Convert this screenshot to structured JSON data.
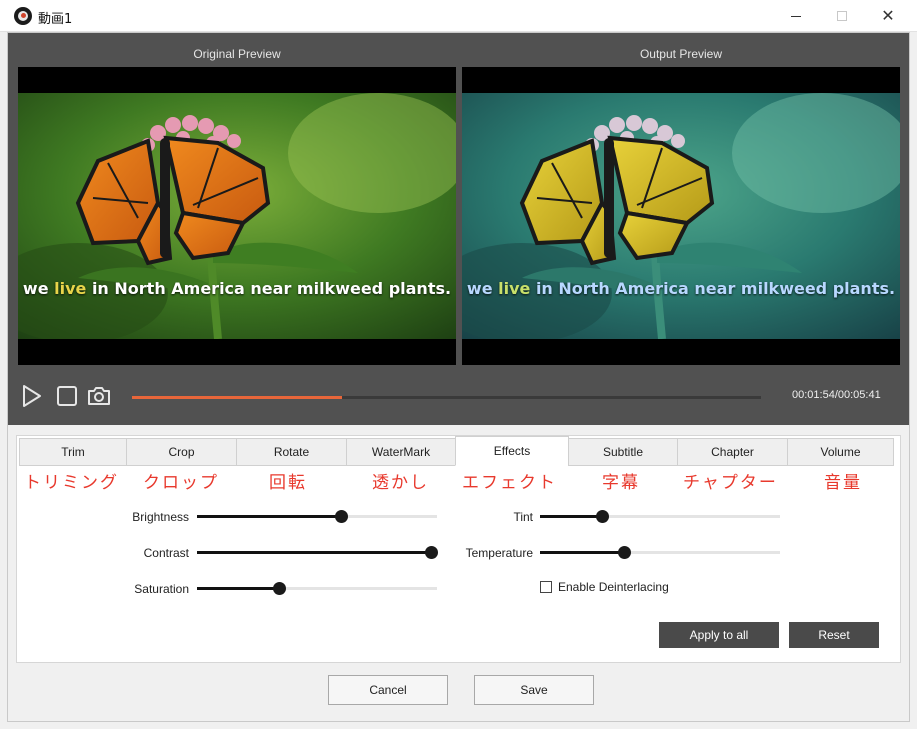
{
  "window": {
    "title": "動画1",
    "close_glyph": "✕"
  },
  "preview": {
    "original_label": "Original Preview",
    "output_label": "Output Preview",
    "caption_pre": "we ",
    "caption_highlight": "live",
    "caption_post": " in North America near milkweed plants."
  },
  "playback": {
    "time": "00:01:54/00:05:41",
    "progress": 0.334
  },
  "tabs": [
    {
      "label": "Trim",
      "jp": "トリミング"
    },
    {
      "label": "Crop",
      "jp": "クロップ"
    },
    {
      "label": "Rotate",
      "jp": "回転"
    },
    {
      "label": "WaterMark",
      "jp": "透かし"
    },
    {
      "label": "Effects",
      "jp": "エフェクト",
      "active": true
    },
    {
      "label": "Subtitle",
      "jp": "字幕"
    },
    {
      "label": "Chapter",
      "jp": "チャプター"
    },
    {
      "label": "Volume",
      "jp": "音量"
    }
  ],
  "effects": {
    "brightness": {
      "label": "Brightness",
      "value": 0.6
    },
    "contrast": {
      "label": "Contrast",
      "value": 1.0
    },
    "saturation": {
      "label": "Saturation",
      "value": 0.34
    },
    "tint": {
      "label": "Tint",
      "value": 0.26
    },
    "temperature": {
      "label": "Temperature",
      "value": 0.35
    },
    "deinterlace_label": "Enable Deinterlacing",
    "deinterlace_checked": false
  },
  "buttons": {
    "apply_all": "Apply to all",
    "reset": "Reset",
    "cancel": "Cancel",
    "save": "Save"
  },
  "colors": {
    "accent": "#e8663a",
    "preview_bg": "#515151",
    "jp_label": "#e8392d"
  }
}
